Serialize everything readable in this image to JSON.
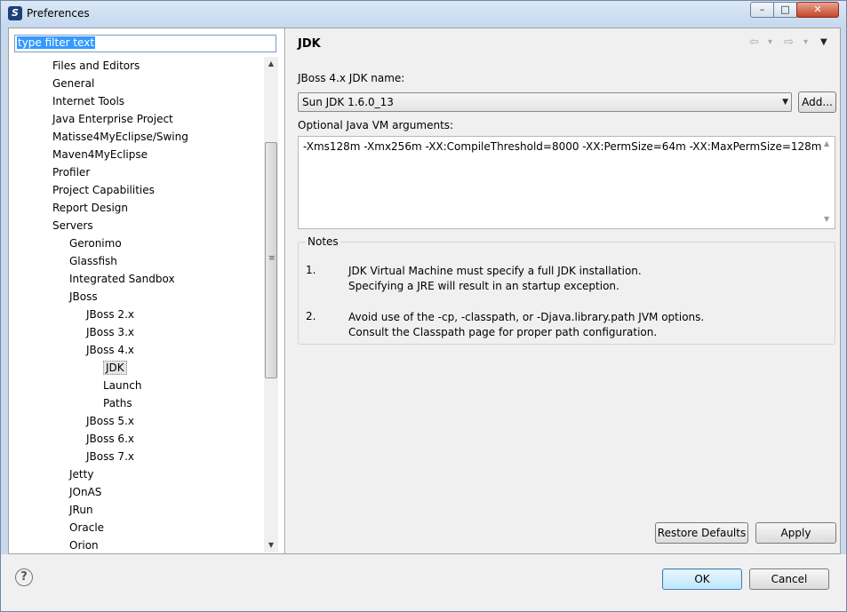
{
  "window": {
    "title": "Preferences",
    "app_icon": "S",
    "controls": {
      "minimize": "–",
      "maximize": "□",
      "close": "✕"
    }
  },
  "filter": {
    "value": "type filter text"
  },
  "tree": {
    "items": [
      {
        "label": "Files and Editors",
        "level": 0
      },
      {
        "label": "General",
        "level": 0
      },
      {
        "label": "Internet Tools",
        "level": 0
      },
      {
        "label": "Java Enterprise Project",
        "level": 0
      },
      {
        "label": "Matisse4MyEclipse/Swing",
        "level": 0
      },
      {
        "label": "Maven4MyEclipse",
        "level": 0
      },
      {
        "label": "Profiler",
        "level": 0
      },
      {
        "label": "Project Capabilities",
        "level": 0
      },
      {
        "label": "Report Design",
        "level": 0
      },
      {
        "label": "Servers",
        "level": 0
      },
      {
        "label": "Geronimo",
        "level": 1
      },
      {
        "label": "Glassfish",
        "level": 1
      },
      {
        "label": "Integrated Sandbox",
        "level": 1
      },
      {
        "label": "JBoss",
        "level": 1
      },
      {
        "label": "JBoss  2.x",
        "level": 2
      },
      {
        "label": "JBoss  3.x",
        "level": 2
      },
      {
        "label": "JBoss  4.x",
        "level": 2
      },
      {
        "label": "JDK",
        "level": 3,
        "selected": true
      },
      {
        "label": "Launch",
        "level": 3
      },
      {
        "label": "Paths",
        "level": 3
      },
      {
        "label": "JBoss  5.x",
        "level": 2
      },
      {
        "label": "JBoss  6.x",
        "level": 2
      },
      {
        "label": "JBoss  7.x",
        "level": 2
      },
      {
        "label": "Jetty",
        "level": 1
      },
      {
        "label": "JOnAS",
        "level": 1
      },
      {
        "label": "JRun",
        "level": 1
      },
      {
        "label": "Oracle",
        "level": 1
      },
      {
        "label": "Orion",
        "level": 1
      }
    ]
  },
  "page": {
    "title": "JDK",
    "nav": {
      "back": "⇦",
      "back_menu": "▾",
      "forward": "⇨",
      "forward_menu": "▾",
      "view_menu": "▼"
    },
    "jdk_name_label": "JBoss  4.x JDK name:",
    "jdk_selected": "Sun JDK 1.6.0_13",
    "add_button": "Add...",
    "vm_args_label": "Optional Java VM arguments:",
    "vm_args_value": "-Xms128m -Xmx256m -XX:CompileThreshold=8000 -XX:PermSize=64m -XX:MaxPermSize=128m",
    "notes": {
      "title": "Notes",
      "items": [
        {
          "num": "1.",
          "line1": "JDK Virtual Machine must specify a full JDK installation.",
          "line2": "Specifying a JRE will result in an startup exception."
        },
        {
          "num": "2.",
          "line1": "Avoid use of the -cp, -classpath, or -Djava.library.path JVM options.",
          "line2": "Consult the Classpath page for proper path configuration."
        }
      ]
    },
    "restore_defaults": "Restore Defaults",
    "apply": "Apply"
  },
  "footer": {
    "help": "?",
    "ok": "OK",
    "cancel": "Cancel"
  }
}
